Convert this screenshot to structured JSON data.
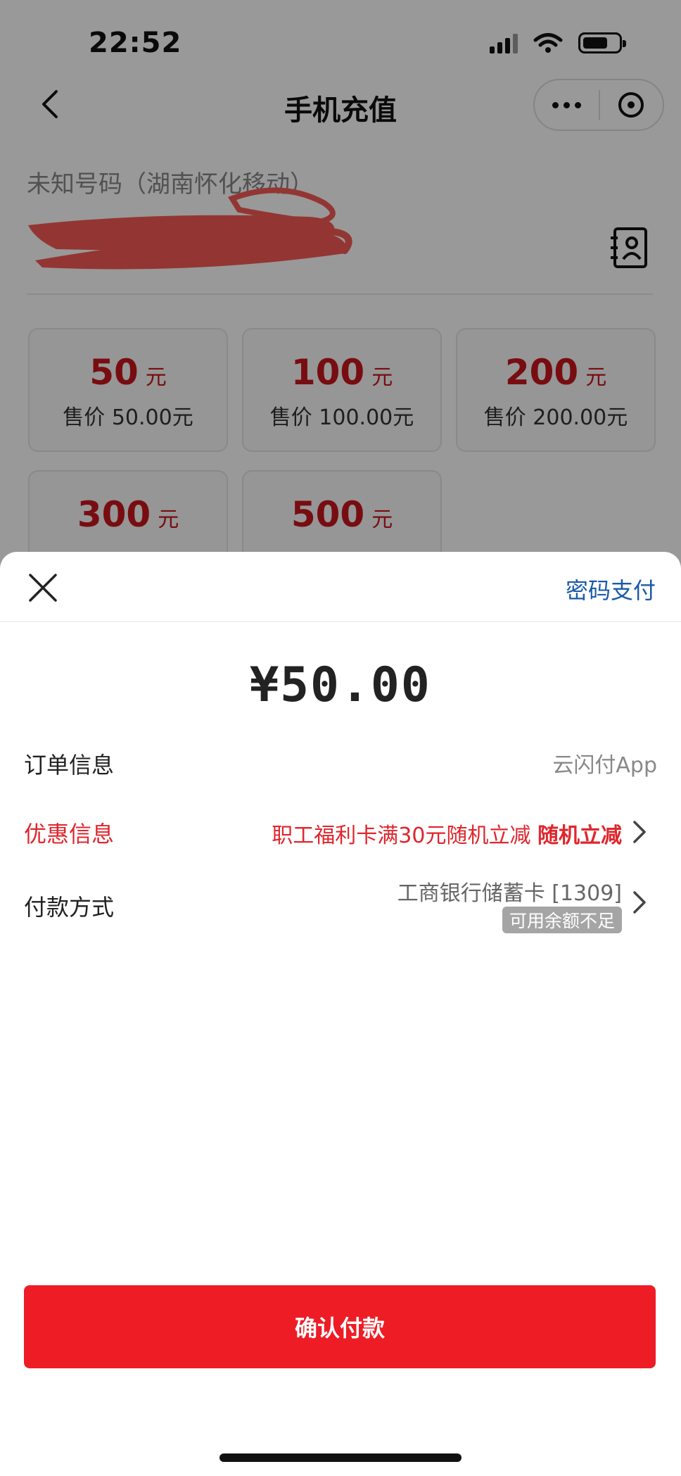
{
  "status_bar": {
    "time": "22:52"
  },
  "nav": {
    "title": "手机充值"
  },
  "phone": {
    "label": "未知号码（湖南怀化移动）"
  },
  "amounts": [
    {
      "value": "50",
      "unit": "元",
      "price": "售价 50.00元"
    },
    {
      "value": "100",
      "unit": "元",
      "price": "售价 100.00元"
    },
    {
      "value": "200",
      "unit": "元",
      "price": "售价 200.00元"
    },
    {
      "value": "300",
      "unit": "元",
      "price": ""
    },
    {
      "value": "500",
      "unit": "元",
      "price": ""
    }
  ],
  "sheet": {
    "password_pay": "密码支付",
    "amount": "¥50.00",
    "order": {
      "label": "订单信息",
      "value": "云闪付App"
    },
    "promo": {
      "label": "优惠信息",
      "value": "职工福利卡满30元随机立减",
      "highlight": "随机立减"
    },
    "method": {
      "label": "付款方式",
      "bank": "工商银行储蓄卡 [1309]",
      "badge": "可用余额不足"
    },
    "confirm": "确认付款"
  },
  "colors": {
    "accent_red": "#ee1c25",
    "amount_red": "#c8161d",
    "link_blue": "#1a5aa8"
  }
}
